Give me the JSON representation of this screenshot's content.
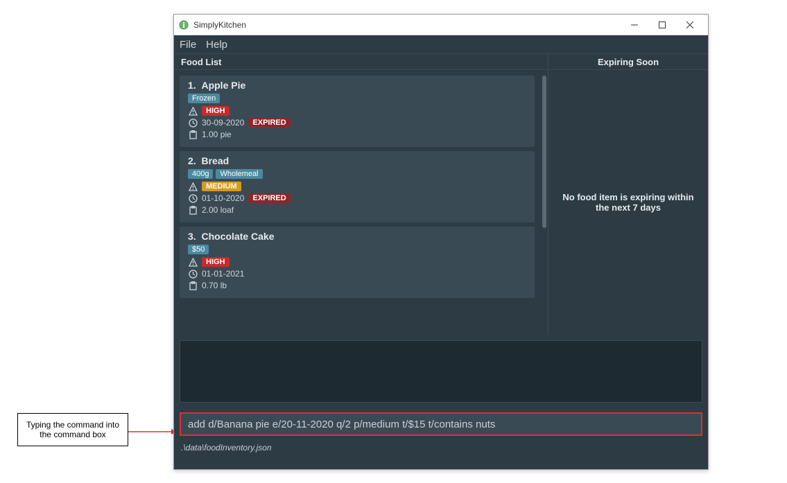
{
  "annotation": {
    "text": "Typing the command into the command box"
  },
  "window": {
    "title": "SimplyKitchen"
  },
  "menu": {
    "file": "File",
    "help": "Help"
  },
  "headers": {
    "food_list": "Food List",
    "expiring_soon": "Expiring Soon"
  },
  "food": [
    {
      "index": "1.",
      "name": "Apple Pie",
      "tags": [
        "Frozen"
      ],
      "priority": "HIGH",
      "expiry": "30-09-2020",
      "expired": "EXPIRED",
      "qty": "1.00 pie"
    },
    {
      "index": "2.",
      "name": "Bread",
      "tags": [
        "400g",
        "Wholemeal"
      ],
      "priority": "MEDIUM",
      "expiry": "01-10-2020",
      "expired": "EXPIRED",
      "qty": "2.00 loaf"
    },
    {
      "index": "3.",
      "name": "Chocolate Cake",
      "tags": [
        "$50"
      ],
      "priority": "HIGH",
      "expiry": "01-01-2021",
      "expired": "",
      "qty": "0.70 lb"
    }
  ],
  "expiring": {
    "empty_text": "No food item is expiring within the next 7 days"
  },
  "command": {
    "value": "add d/Banana pie e/20-11-2020 q/2 p/medium t/$15 t/contains nuts"
  },
  "statusbar": {
    "path": ".\\data\\foodInventory.json"
  },
  "icons": {
    "priority": "warning-icon",
    "expiry": "clock-icon",
    "qty": "clipboard-icon"
  }
}
